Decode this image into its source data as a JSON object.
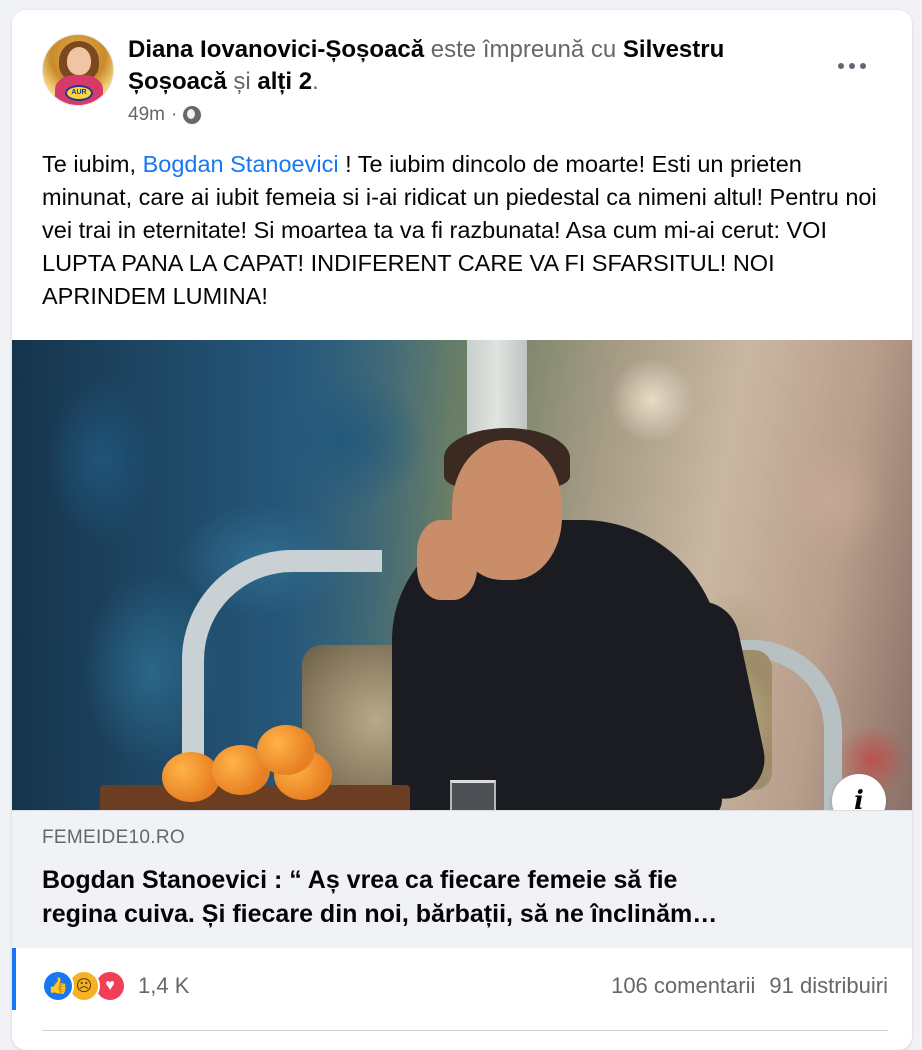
{
  "post": {
    "author": "Diana Iovanovici-Șoșoacă",
    "with_text": "este împreună cu",
    "tagged": "Silvestru Șoșoacă",
    "and_text": "și",
    "others": "alți 2",
    "period": ".",
    "time": "49m",
    "dot": "·",
    "privacy_icon": "globe-icon",
    "avatar_badge": "AUR",
    "text_before_mention": "Te iubim,",
    "mention": "Bogdan Stanoevici",
    "text_after_mention": " ! Te iubim dincolo de moarte! Esti un prieten minunat, care ai iubit femeia si i-ai ridicat un piedestal ca nimeni altul! Pentru noi vei trai in eternitate! Si moartea ta va fi razbunata! Asa cum mi-ai cerut: VOI LUPTA PANA LA CAPAT! INDIFERENT CARE VA FI SFARSITUL! NOI APRINDEM LUMINA!"
  },
  "link": {
    "domain": "FEMEIDE10.RO",
    "title_line1": "Bogdan Stanoevici : “ Aș vrea ca fiecare femeie să fie",
    "title_line2": "regina cuiva. Și fiecare din noi, bărbații, să ne înclinăm…",
    "info_label": "i"
  },
  "footer": {
    "reaction_icons": [
      "like-icon",
      "sad-icon",
      "love-icon"
    ],
    "reaction_count": "1,4 K",
    "comments": "106 comentarii",
    "shares": "91 distribuiri"
  },
  "colors": {
    "link_blue": "#1877f2",
    "muted_gray": "#65676b",
    "like": "#1877f2",
    "sad": "#f7b125",
    "love": "#f33e58"
  }
}
